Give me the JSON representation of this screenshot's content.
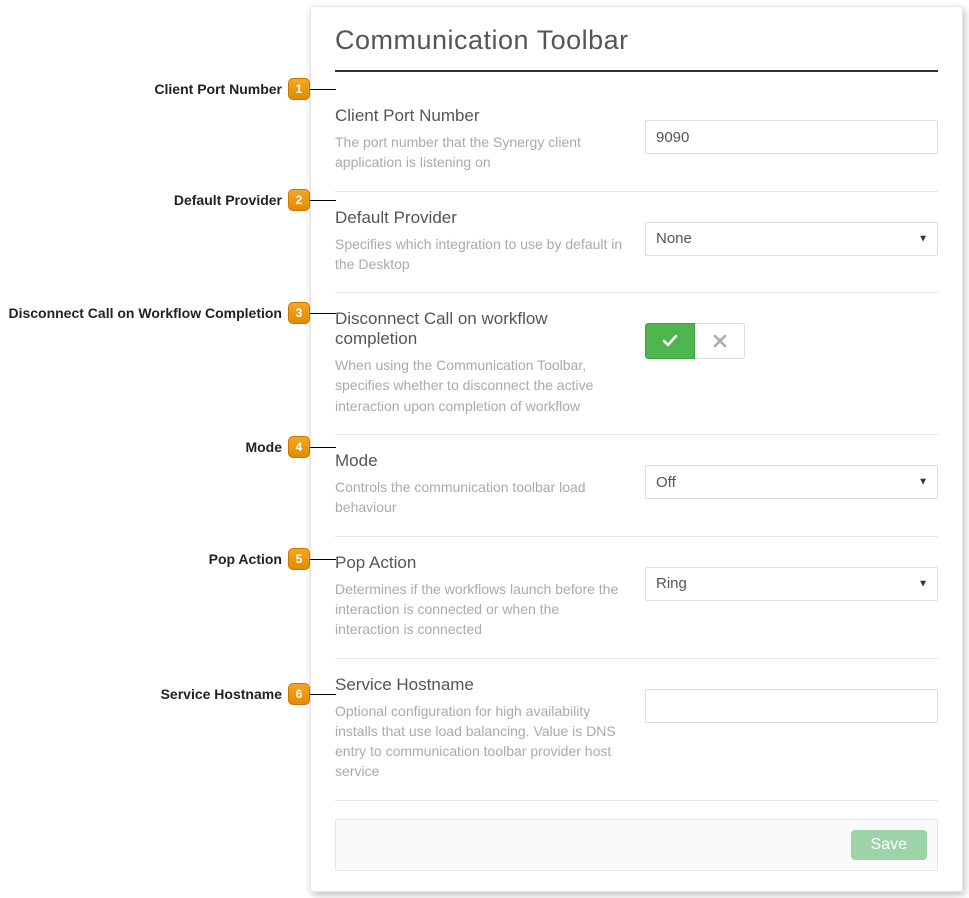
{
  "panel": {
    "title": "Communication Toolbar",
    "save_label": "Save"
  },
  "callouts": [
    {
      "label": "Client Port Number",
      "num": "1"
    },
    {
      "label": "Default Provider",
      "num": "2"
    },
    {
      "label": "Disconnect Call on Workflow Completion",
      "num": "3"
    },
    {
      "label": "Mode",
      "num": "4"
    },
    {
      "label": "Pop Action",
      "num": "5"
    },
    {
      "label": "Service Hostname",
      "num": "6"
    }
  ],
  "rows": [
    {
      "heading": "Client Port Number",
      "desc": "The port number that the Synergy client application is listening on",
      "value": "9090"
    },
    {
      "heading": "Default Provider",
      "desc": "Specifies which integration to use by default in the Desktop",
      "value": "None"
    },
    {
      "heading": "Disconnect Call on workflow completion",
      "desc": "When using the Communication Toolbar, specifies whether to disconnect the active interaction upon completion of workflow"
    },
    {
      "heading": "Mode",
      "desc": "Controls the communication toolbar load behaviour",
      "value": "Off"
    },
    {
      "heading": "Pop Action",
      "desc": "Determines if the workflows launch before the interaction is connected or when the interaction is connected",
      "value": "Ring"
    },
    {
      "heading": "Service Hostname",
      "desc": "Optional configuration for high availability installs that use load balancing. Value is DNS entry to communication toolbar provider host service",
      "value": ""
    }
  ]
}
